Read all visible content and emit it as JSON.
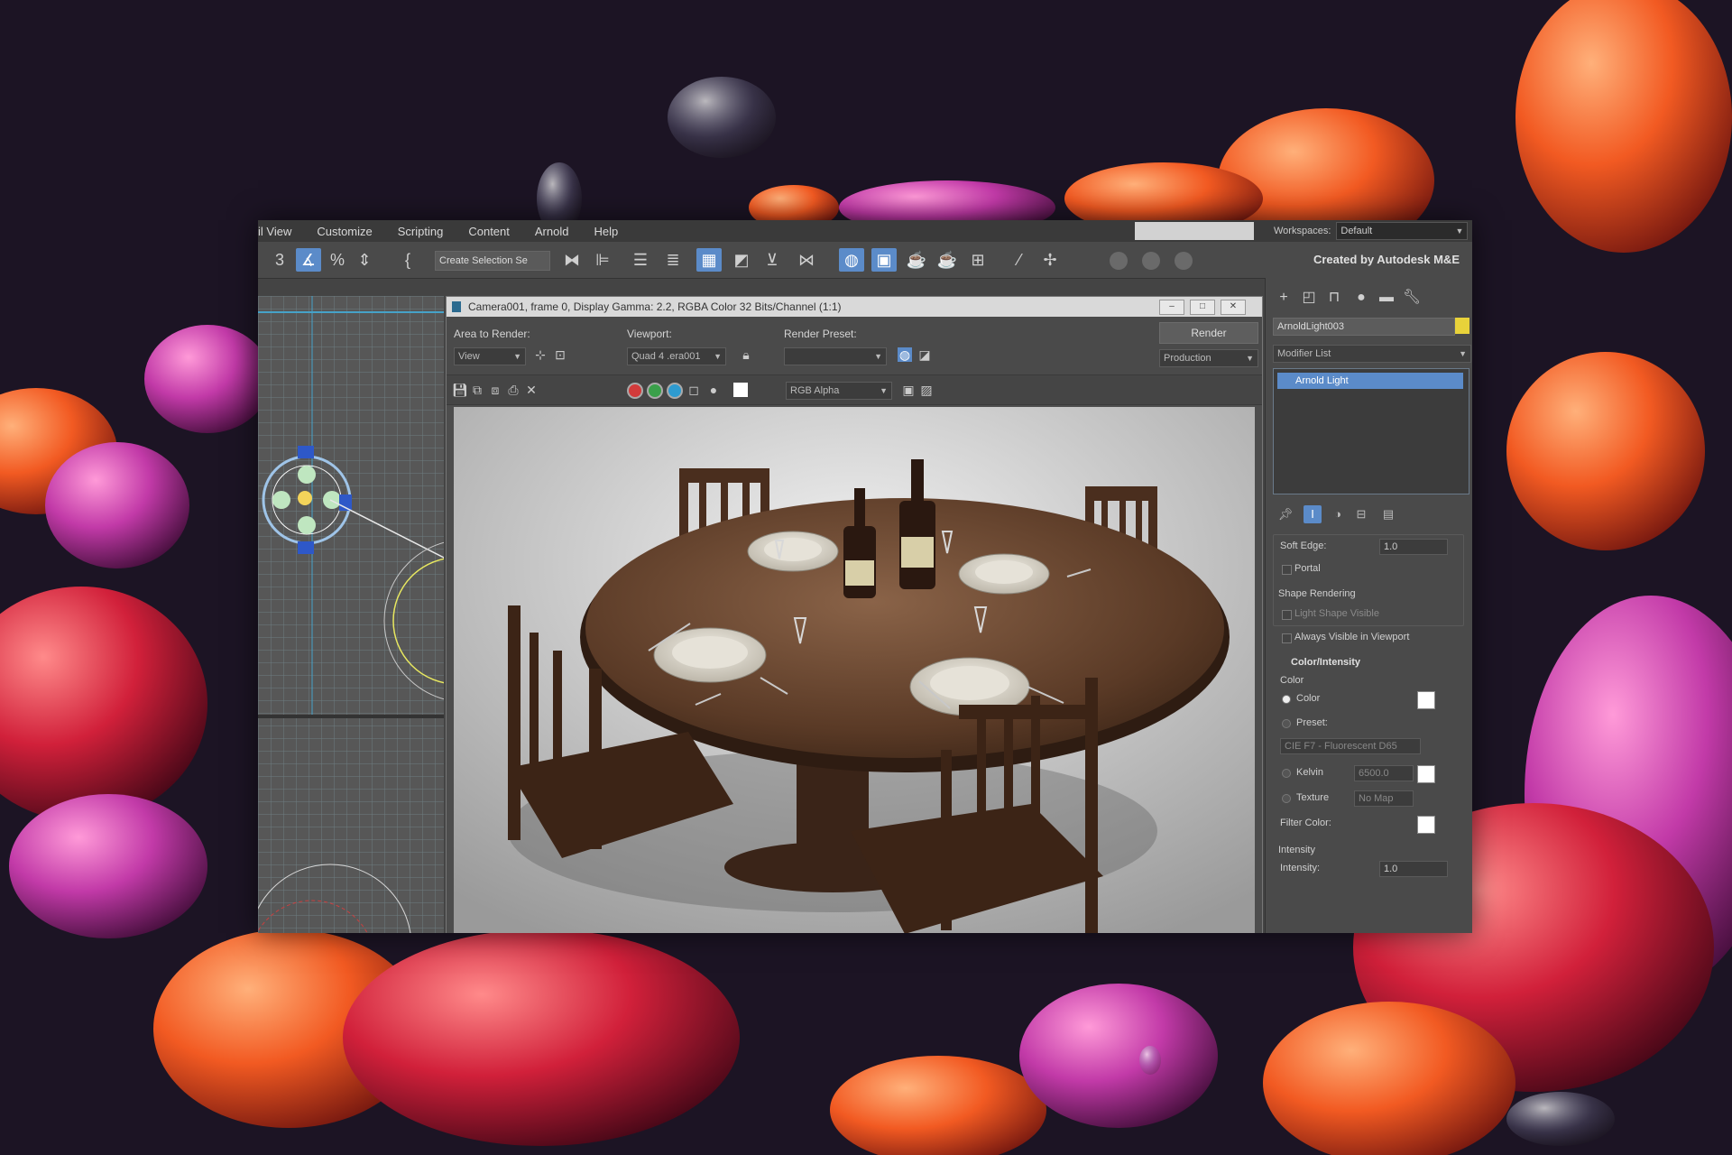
{
  "menu": [
    "il View",
    "Customize",
    "Scripting",
    "Content",
    "Arnold",
    "Help"
  ],
  "workspace": {
    "label": "Workspaces:",
    "value": "Default"
  },
  "toolbar": {
    "selection_set_placeholder": "Create Selection Se",
    "credit": "Created by Autodesk M&E"
  },
  "render_window": {
    "title": "Camera001, frame 0, Display Gamma: 2.2, RGBA Color 32 Bits/Channel (1:1)",
    "area_label": "Area to Render:",
    "area_value": "View",
    "viewport_label": "Viewport:",
    "viewport_value": "Quad 4 .era001",
    "preset_label": "Render Preset:",
    "preset_value": "",
    "render_button": "Render",
    "mode_value": "Production",
    "channel_value": "RGB Alpha"
  },
  "command_panel": {
    "object_name": "ArnoldLight003",
    "object_color": "#e8d23a",
    "modifier_list": "Modifier List",
    "stack_item": "Arnold Light",
    "soft_edge_label": "Soft Edge:",
    "soft_edge_value": "1.0",
    "portal_label": "Portal",
    "shape_rendering_header": "Shape Rendering",
    "light_shape_visible": "Light Shape Visible",
    "always_visible": "Always Visible in Viewport",
    "color_intensity_header": "Color/Intensity",
    "color_group": "Color",
    "color_option": "Color",
    "preset_option": "Preset:",
    "preset_value": "CIE F7 - Fluorescent D65",
    "kelvin_option": "Kelvin",
    "kelvin_value": "6500.0",
    "texture_option": "Texture",
    "texture_value": "No Map",
    "filter_color_label": "Filter Color:",
    "intensity_group": "Intensity",
    "intensity_label": "Intensity:",
    "intensity_value": "1.0"
  },
  "colors": {
    "accent": "#5b8bc9",
    "panel": "#4a4a4a"
  }
}
